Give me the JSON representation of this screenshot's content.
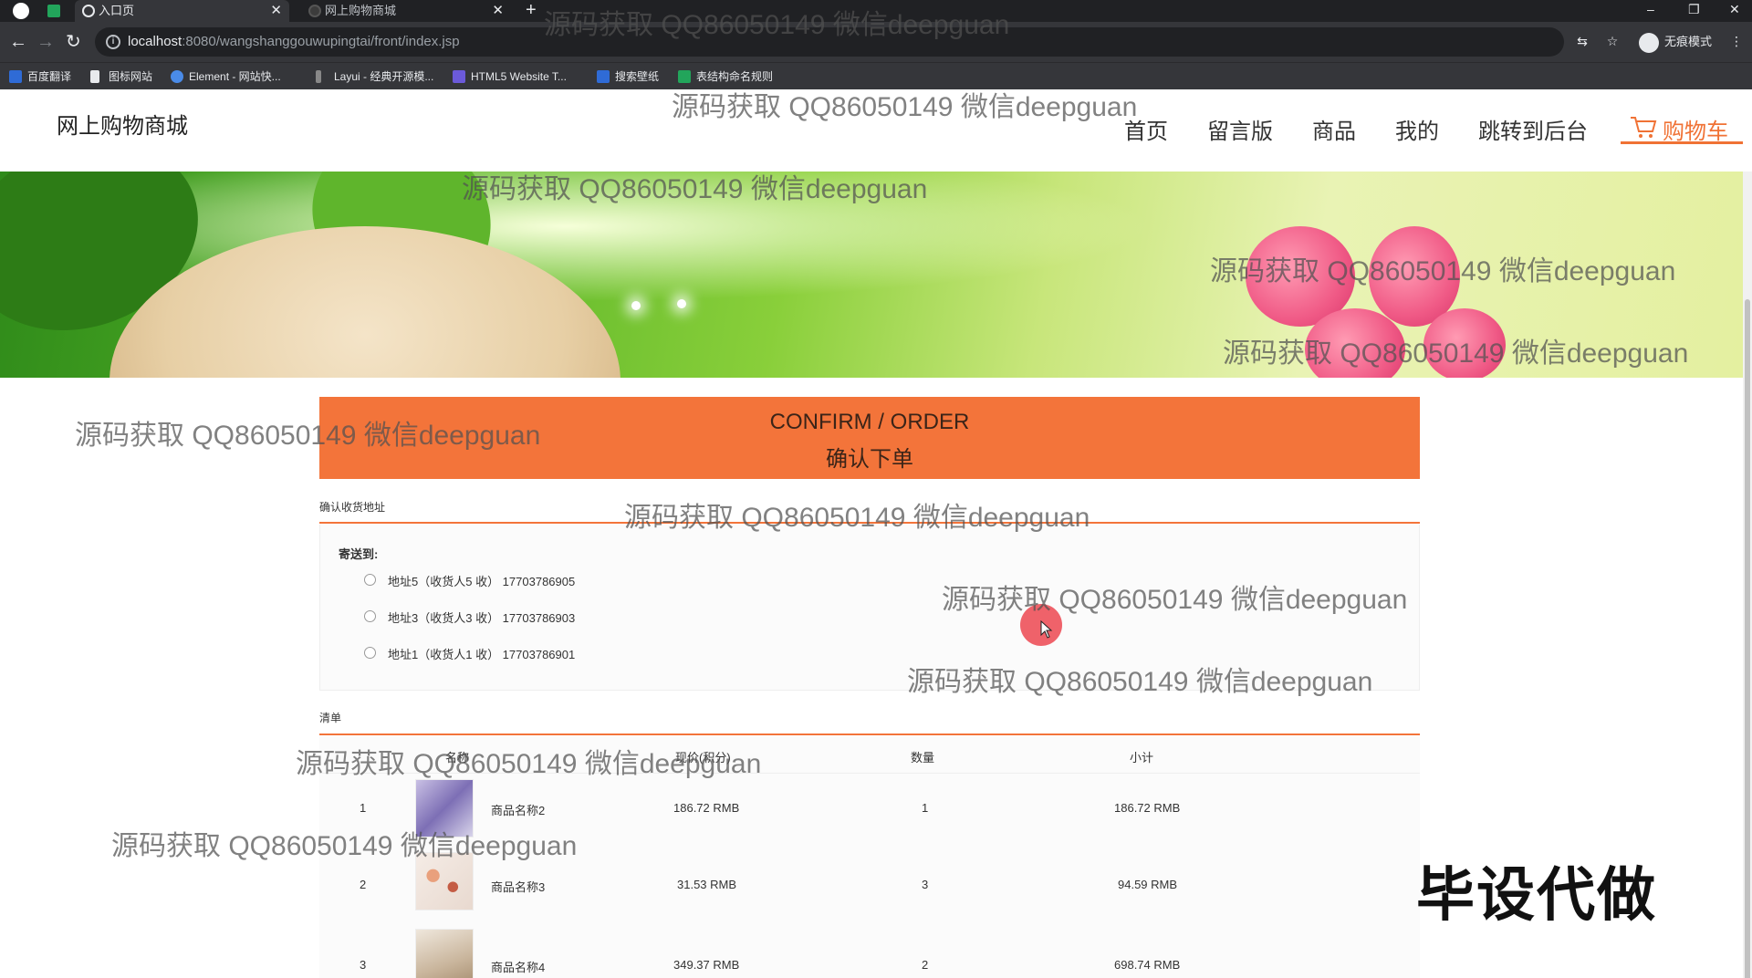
{
  "browser": {
    "tabs": [
      {
        "label": "入口页",
        "active": true
      },
      {
        "label": "网上购物商城",
        "active": false
      }
    ],
    "url_host": "localhost",
    "url_rest": ":8080/wangshanggouwupingtai/front/index.jsp",
    "profile_label": "无痕模式",
    "bookmarks": [
      "百度翻译",
      "图标网站",
      "Element - 网站快...",
      "Layui - 经典开源模...",
      "HTML5 Website T...",
      "搜索壁纸",
      "表结构命名规则"
    ]
  },
  "site": {
    "logo": "网上购物商城",
    "nav": [
      "首页",
      "留言版",
      "商品",
      "我的",
      "跳转到后台"
    ],
    "cart": "购物车"
  },
  "order": {
    "title_en": "CONFIRM / ORDER",
    "title_zh": "确认下单",
    "address_section": "确认收货地址",
    "send_to": "寄送到:",
    "addresses": [
      "地址5（收货人5 收） 17703786905",
      "地址3（收货人3 收） 17703786903",
      "地址1（收货人1 收） 17703786901"
    ],
    "list_section": "清单",
    "columns": [
      "名称",
      "现价(积分)",
      "数量",
      "小计"
    ],
    "items": [
      {
        "index": "1",
        "name": "商品名称2",
        "price": "186.72 RMB",
        "qty": "1",
        "subtotal": "186.72 RMB"
      },
      {
        "index": "2",
        "name": "商品名称3",
        "price": "31.53 RMB",
        "qty": "3",
        "subtotal": "94.59 RMB"
      },
      {
        "index": "3",
        "name": "商品名称4",
        "price": "349.37 RMB",
        "qty": "2",
        "subtotal": "698.74 RMB"
      }
    ]
  },
  "overlay": {
    "watermark": "源码获取 QQ86050149 微信deepguan",
    "stamp": "毕设代做"
  },
  "colors": {
    "accent": "#f3743a",
    "chrome_dark": "#202124",
    "chrome": "#35363a"
  }
}
